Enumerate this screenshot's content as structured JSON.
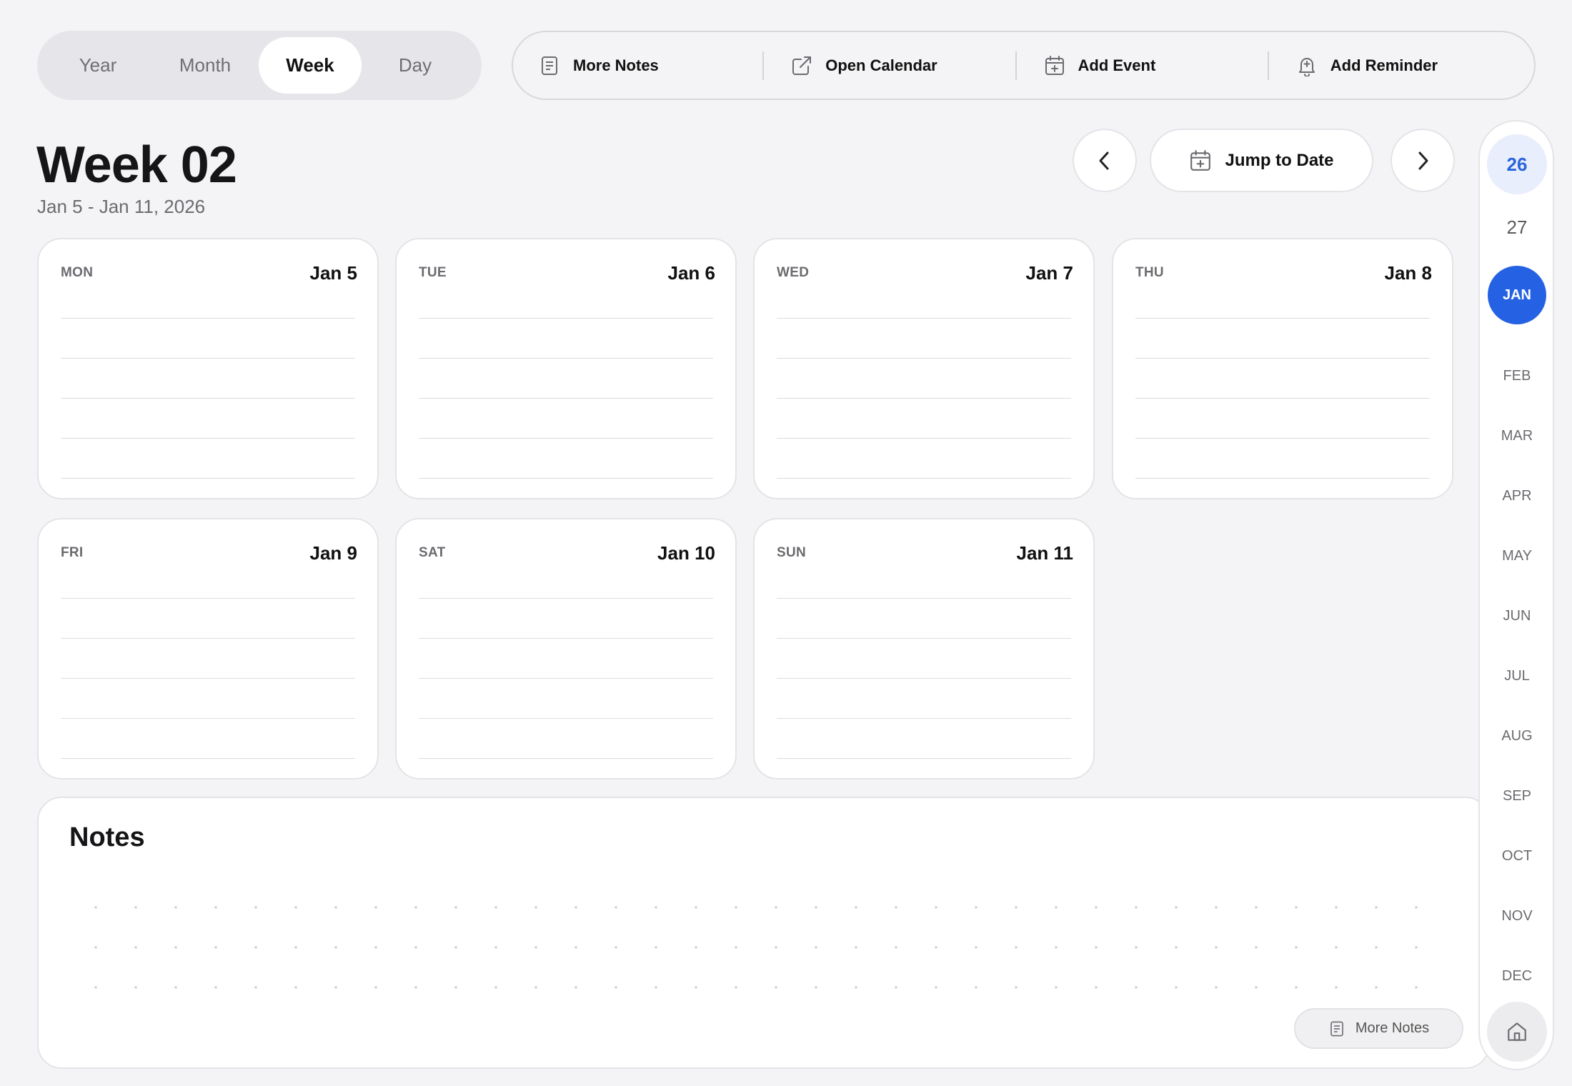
{
  "view_switch": {
    "options": [
      "Year",
      "Month",
      "Week",
      "Day"
    ],
    "selected": "Week"
  },
  "actions": [
    {
      "label": "More Notes",
      "icon": "notes-icon"
    },
    {
      "label": "Open Calendar",
      "icon": "external-link-icon"
    },
    {
      "label": "Add Event",
      "icon": "calendar-add-icon"
    },
    {
      "label": "Add Reminder",
      "icon": "bell-add-icon"
    }
  ],
  "header": {
    "title": "Week 02",
    "range": "Jan 5 - Jan 11, 2026"
  },
  "nav": {
    "prev_icon": "chevron-left-icon",
    "jump_label": "Jump to Date",
    "jump_icon": "calendar-add-icon",
    "next_icon": "chevron-right-icon"
  },
  "days": [
    {
      "name": "MON",
      "date": "Jan 5"
    },
    {
      "name": "TUE",
      "date": "Jan 6"
    },
    {
      "name": "WED",
      "date": "Jan 7"
    },
    {
      "name": "THU",
      "date": "Jan 8"
    },
    {
      "name": "FRI",
      "date": "Jan 9"
    },
    {
      "name": "SAT",
      "date": "Jan 10"
    },
    {
      "name": "SUN",
      "date": "Jan 11"
    }
  ],
  "notes": {
    "title": "Notes",
    "more_label": "More Notes",
    "more_icon": "notes-icon"
  },
  "rail": {
    "years": [
      "26",
      "27"
    ],
    "selected_year": "26",
    "months": [
      "JAN",
      "FEB",
      "MAR",
      "APR",
      "MAY",
      "JUN",
      "JUL",
      "AUG",
      "SEP",
      "OCT",
      "NOV",
      "DEC"
    ],
    "selected_month": "JAN",
    "home_icon": "home-icon"
  },
  "colors": {
    "accent": "#2562e3",
    "accent_light": "#e8eefb",
    "background": "#f4f4f6",
    "card": "#ffffff"
  }
}
